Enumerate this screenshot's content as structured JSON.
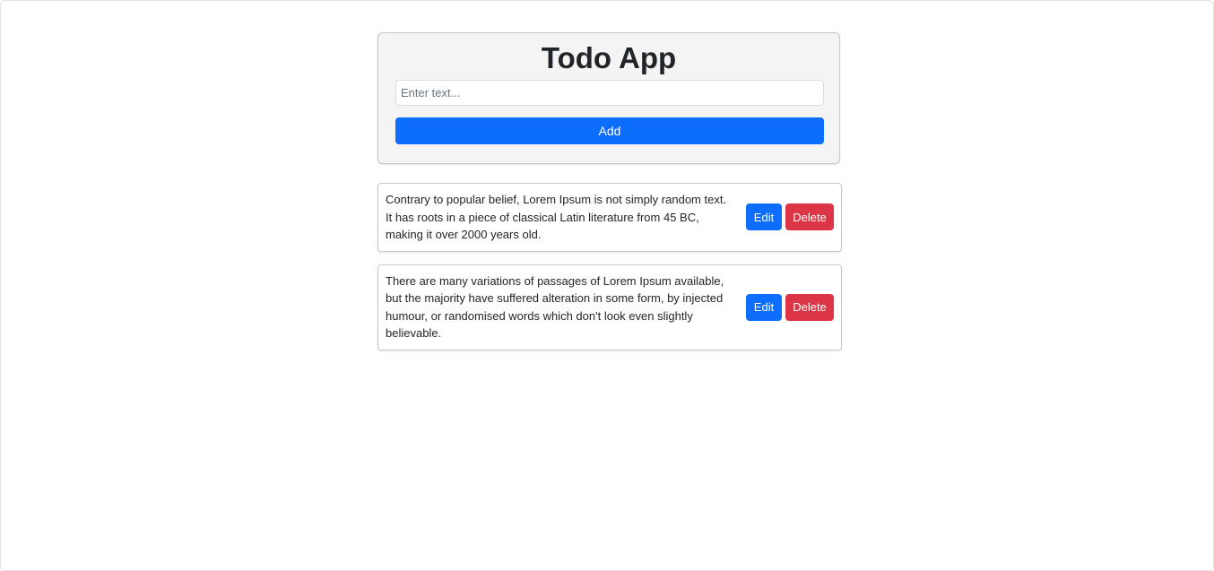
{
  "app": {
    "title": "Todo App"
  },
  "form": {
    "input_value": "",
    "input_placeholder": "Enter text...",
    "add_label": "Add"
  },
  "colors": {
    "primary": "#0d6efd",
    "danger": "#dc3545",
    "card_background": "#f4f4f4"
  },
  "todos": [
    {
      "text": "Contrary to popular belief, Lorem Ipsum is not simply random text. It has roots in a piece of classical Latin literature from 45 BC, making it over 2000 years old.",
      "edit_label": "Edit",
      "delete_label": "Delete"
    },
    {
      "text": "There are many variations of passages of Lorem Ipsum available, but the majority have suffered alteration in some form, by injected humour, or randomised words which don't look even slightly believable.",
      "edit_label": "Edit",
      "delete_label": "Delete"
    }
  ]
}
